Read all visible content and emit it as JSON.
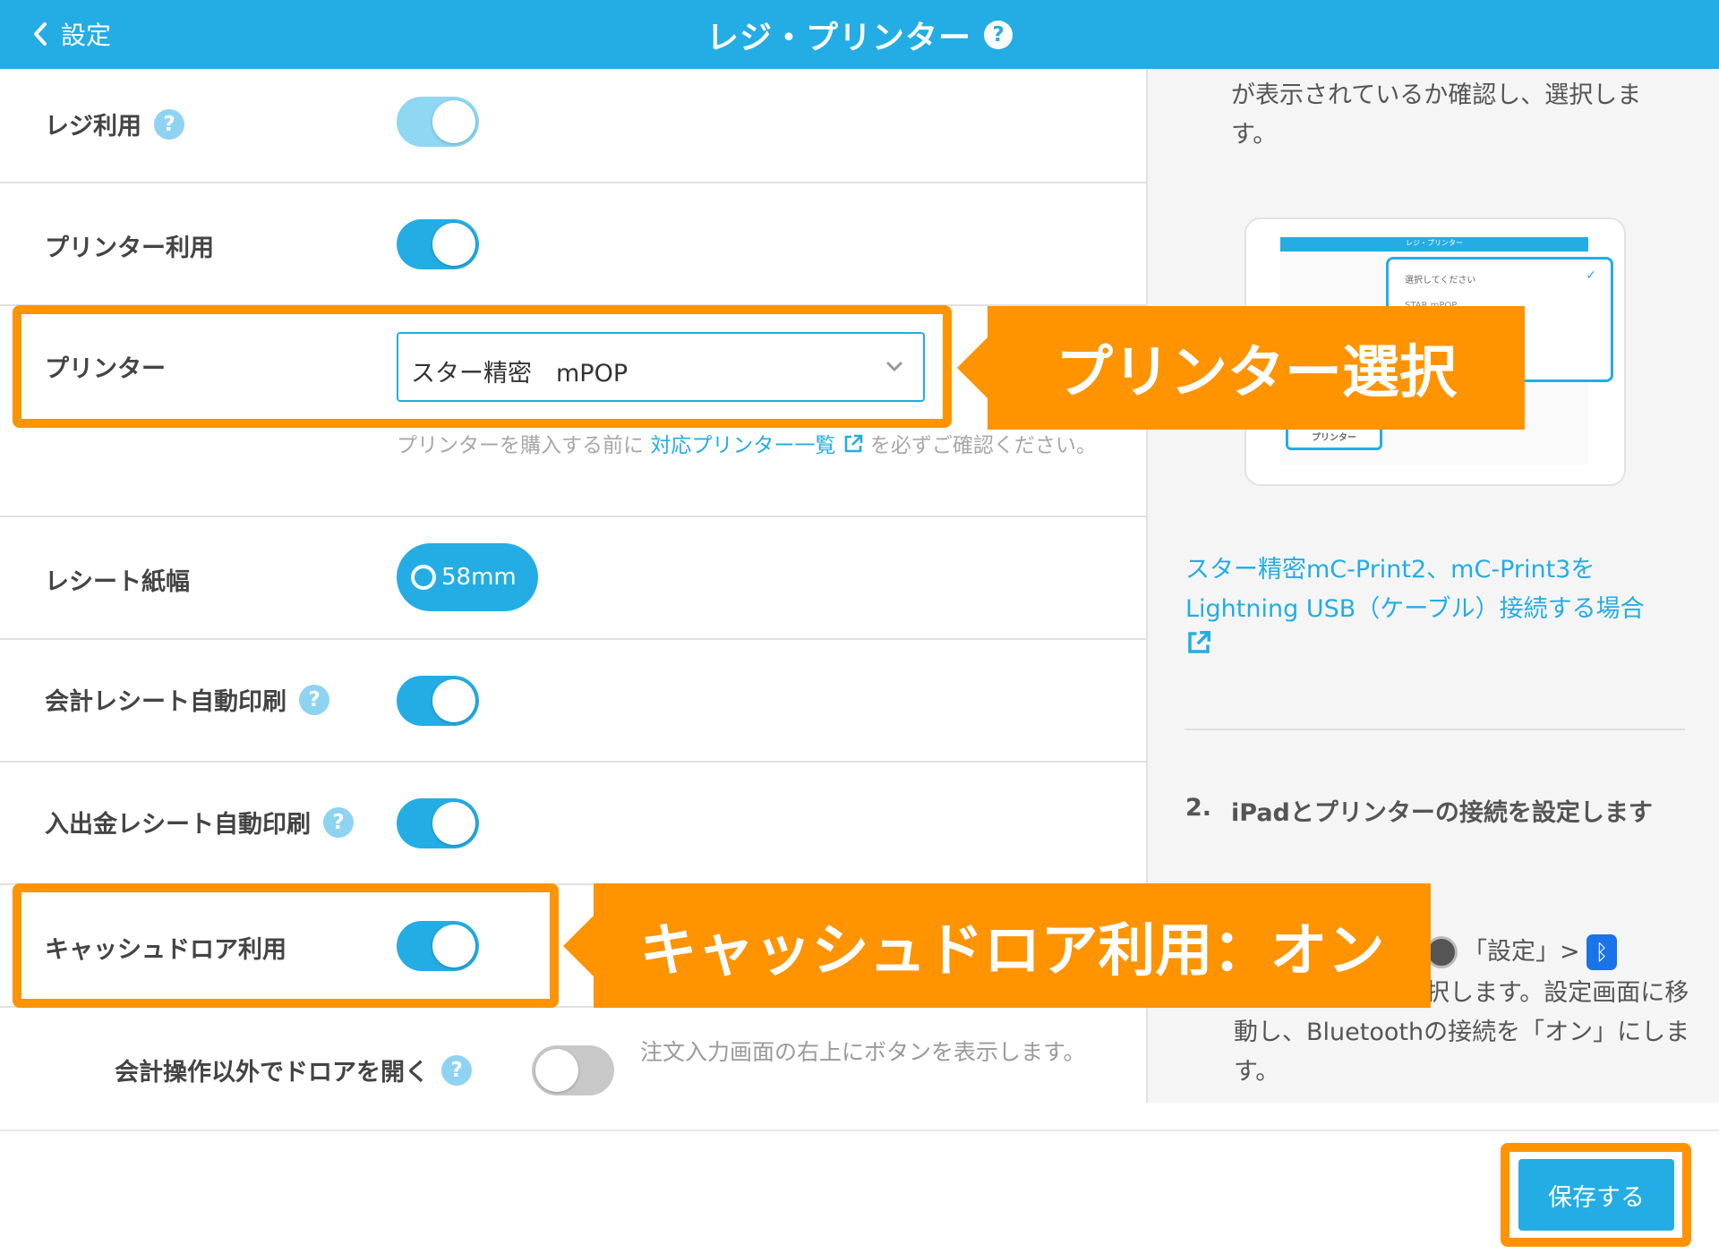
{
  "header": {
    "back_label": "設定",
    "title": "レジ・プリンター",
    "help_glyph": "?"
  },
  "settings": {
    "register_use": "レジ利用",
    "printer_use": "プリンター利用",
    "printer": "プリンター",
    "printer_value": "スター精密　mPOP",
    "printer_note_before": "プリンターを購入する前に ",
    "printer_note_link": "対応プリンター一覧",
    "printer_note_after": " を必ずご確認ください。",
    "receipt_width": "レシート紙幅",
    "receipt_width_value": "58mm",
    "auto_print_checkout": "会計レシート自動印刷",
    "auto_print_cash": "入出金レシート自動印刷",
    "cash_drawer_use": "キャッシュドロア利用",
    "open_drawer_other": "会計操作以外でドロアを開く",
    "open_drawer_note": "注文入力画面の右上にボタンを表示します。"
  },
  "help_panel": {
    "intro_text": "が表示されているか確認し、選択します。",
    "illus_header": "レジ・プリンター",
    "illus_select": "選択してください",
    "illus_option": "STAR mPOP",
    "illus_label": "プリンター",
    "link_text": "スター精密mC-Print2、mC-Print3をLightning USB（ケーブル）接続する場合",
    "step_number": "2.",
    "step_title": "iPadとプリンターの接続を設定します",
    "step_body_line1": "「設定」>",
    "step_body_rest": "択します。設定画面に移動し、Bluetoothの接続を「オン」にします。"
  },
  "footer": {
    "save_label": "保存する"
  },
  "annotations": {
    "printer_select_callout": "プリンター選択",
    "cash_drawer_callout": "キャッシュドロア利用：オン"
  },
  "colors": {
    "primary": "#23ade4",
    "accent": "#ff9300",
    "toggle_off": "#c8c8c8"
  },
  "toggles": {
    "register_use": true,
    "printer_use": true,
    "auto_print_checkout": true,
    "auto_print_cash": true,
    "cash_drawer_use": true,
    "open_drawer_other": false
  }
}
